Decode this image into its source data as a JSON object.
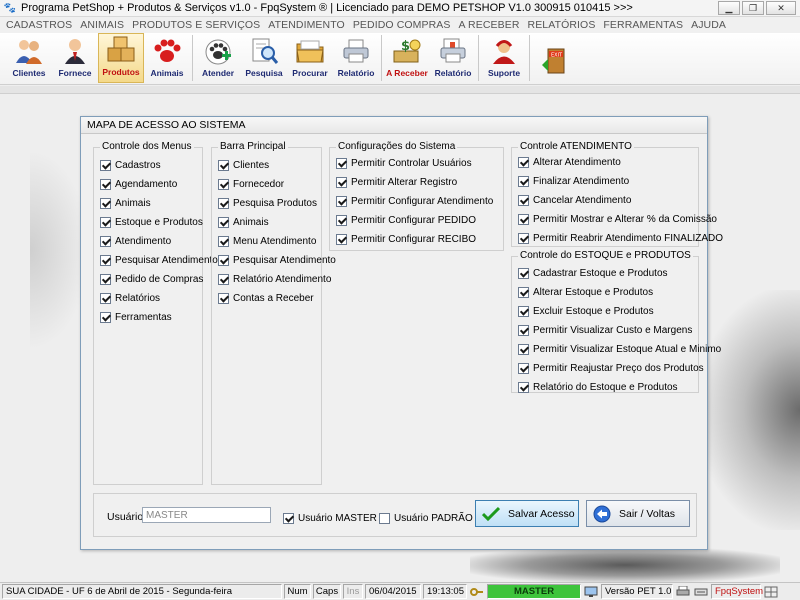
{
  "window": {
    "title": "Programa PetShop + Produtos & Serviços v1.0 - FpqSystem ® | Licenciado para  DEMO PETSHOP V1.0 300915 010415 >>>",
    "min_label": "▁",
    "max_label": "❐",
    "close_label": "✕"
  },
  "menu": [
    "CADASTROS",
    "ANIMAIS",
    "PRODUTOS E SERVIÇOS",
    "ATENDIMENTO",
    "PEDIDO COMPRAS",
    "A RECEBER",
    "RELATÓRIOS",
    "FERRAMENTAS",
    "AJUDA"
  ],
  "toolbar": {
    "clientes": "Clientes",
    "fornece": "Fornece",
    "produtos": "Produtos",
    "animais": "Animais",
    "atender": "Atender",
    "pesquisa": "Pesquisa",
    "procurar": "Procurar",
    "relatorio": "Relatório",
    "areceber": "A Receber",
    "relatorio2": "Relatório",
    "suporte": "Suporte"
  },
  "dialog": {
    "title": "MAPA DE ACESSO AO SISTEMA",
    "controle_menus": {
      "label": "Controle dos Menus",
      "items": [
        {
          "label": "Cadastros",
          "checked": true
        },
        {
          "label": "Agendamento",
          "checked": true
        },
        {
          "label": "Animais",
          "checked": true
        },
        {
          "label": "Estoque e Produtos",
          "checked": true
        },
        {
          "label": "Atendimento",
          "checked": true
        },
        {
          "label": "Pesquisar Atendimento",
          "checked": true
        },
        {
          "label": "Pedido de Compras",
          "checked": true
        },
        {
          "label": "Relatórios",
          "checked": true
        },
        {
          "label": "Ferramentas",
          "checked": true
        }
      ]
    },
    "barra_principal": {
      "label": "Barra Principal",
      "items": [
        {
          "label": "Clientes",
          "checked": true
        },
        {
          "label": "Fornecedor",
          "checked": true
        },
        {
          "label": "Pesquisa Produtos",
          "checked": true
        },
        {
          "label": "Animais",
          "checked": true
        },
        {
          "label": "Menu Atendimento",
          "checked": true
        },
        {
          "label": "Pesquisar Atendimento",
          "checked": true
        },
        {
          "label": "Relatório Atendimento",
          "checked": true
        },
        {
          "label": "Contas a Receber",
          "checked": true
        }
      ]
    },
    "configuracoes": {
      "label": "Configurações do Sistema",
      "items": [
        {
          "label": "Permitir Controlar Usuários",
          "checked": true
        },
        {
          "label": "Permitir Alterar Registro",
          "checked": true
        },
        {
          "label": "Permitir Configurar Atendimento",
          "checked": true
        },
        {
          "label": "Permitir Configurar PEDIDO",
          "checked": true
        },
        {
          "label": "Permitir Configurar RECIBO",
          "checked": true
        }
      ]
    },
    "controle_atendimento": {
      "label": "Controle ATENDIMENTO",
      "items": [
        {
          "label": "Alterar Atendimento",
          "checked": true
        },
        {
          "label": "Finalizar Atendimento",
          "checked": true
        },
        {
          "label": "Cancelar Atendimento",
          "checked": true
        },
        {
          "label": "Permitir Mostrar e Alterar % da Comissão",
          "checked": true
        },
        {
          "label": "Permitir Reabrir Atendimento FINALIZADO",
          "checked": true
        }
      ]
    },
    "controle_estoque": {
      "label": "Controle do ESTOQUE e PRODUTOS",
      "items": [
        {
          "label": "Cadastrar Estoque e Produtos",
          "checked": true
        },
        {
          "label": "Alterar Estoque e Produtos",
          "checked": true
        },
        {
          "label": "Excluir Estoque e Produtos",
          "checked": true
        },
        {
          "label": "Permitir Visualizar Custo e Margens",
          "checked": true
        },
        {
          "label": "Permitir Visualizar Estoque Atual e Minimo",
          "checked": true
        },
        {
          "label": "Permitir Reajustar Preço dos Produtos",
          "checked": true
        },
        {
          "label": "Relatório do Estoque e Produtos",
          "checked": true
        }
      ]
    },
    "usuario_label": "Usuário:",
    "usuario_value": "MASTER",
    "usuario_master": {
      "label": "Usuário MASTER",
      "checked": true
    },
    "usuario_padrao": {
      "label": "Usuário PADRÃO",
      "checked": false
    },
    "salvar_label": "Salvar Acesso",
    "sair_label": "Sair / Voltas"
  },
  "status": {
    "location": "SUA CIDADE - UF  6 de Abril de 2015 - Segunda-feira",
    "num": "Num",
    "caps": "Caps",
    "ins": "Ins",
    "date": "06/04/2015",
    "time": "19:13:05",
    "user": "MASTER",
    "version": "Versão PET 1.0",
    "brand": "FpqSystem"
  },
  "colors": {
    "accent_blue": "#1e2a72",
    "accent_red": "#c01010",
    "status_green": "#3ec43c"
  }
}
